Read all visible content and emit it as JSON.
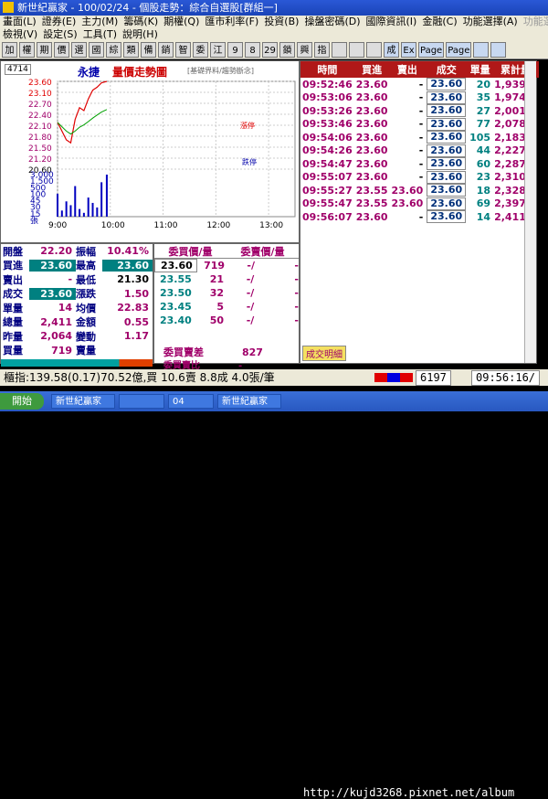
{
  "window": {
    "title": "新世紀贏家 - 100/02/24 - 個股走勢：綜合自選股[群組一]"
  },
  "menu": {
    "row1": [
      "畫面(L)",
      "證券(E)",
      "主力(M)",
      "籌碼(K)",
      "期權(Q)",
      "匯市利率(F)",
      "投資(B)",
      "操盤密碼(D)",
      "國際資訊(I)",
      "金融(C)",
      "功能選擇(A)",
      "功能選擇(V)"
    ],
    "row2": [
      "檢視(V)",
      "設定(S)",
      "工具(T)",
      "說明(H)"
    ]
  },
  "toolbar": {
    "buttons": [
      "加",
      "權",
      "期",
      "價",
      "選",
      "國",
      "綜",
      "類",
      "備",
      "銷",
      "智",
      "委",
      "江",
      "9",
      "8",
      "29",
      "鎖",
      "興",
      "指",
      "",
      "",
      "",
      "成",
      "Ex",
      "Page",
      "Page",
      "",
      ""
    ]
  },
  "chart": {
    "code": "4714",
    "stock_name": "永捷",
    "title": "量價走勢圖",
    "note": "[基礎界料/趨勢斷念]",
    "price_ticks": [
      "23.60",
      "23.10",
      "22.70",
      "22.40",
      "22.10",
      "21.80",
      "21.50",
      "21.20",
      "20.60"
    ],
    "vol_ticks": [
      "3,000",
      "1,500",
      "500",
      "100",
      "45",
      "30",
      "15",
      "張"
    ],
    "time_ticks": [
      "9:00",
      "10:00",
      "11:00",
      "12:00",
      "13:00"
    ],
    "ref_labels": [
      "漲停",
      "跌停"
    ]
  },
  "chart_data": {
    "type": "line",
    "x": [
      "09:00",
      "09:05",
      "09:10",
      "09:15",
      "09:20",
      "09:25",
      "09:30",
      "09:35",
      "09:40",
      "09:45",
      "09:50",
      "09:56"
    ],
    "series": [
      {
        "values": [
          22.2,
          21.9,
          21.6,
          21.5,
          22.3,
          22.7,
          22.6,
          23.0,
          23.3,
          23.4,
          23.55,
          23.6
        ]
      }
    ],
    "ylim": [
      20.6,
      23.6
    ],
    "xlim": [
      "09:00",
      "13:30"
    ],
    "volume": [
      30,
      8,
      20,
      15,
      40,
      10,
      5,
      25,
      18,
      12,
      45,
      55
    ]
  },
  "ticks": {
    "headers": [
      "時間",
      "買進",
      "賣出",
      "成交",
      "單量",
      "累計量"
    ],
    "rows": [
      {
        "time": "09:52:46",
        "bid": "23.60",
        "ask": "",
        "chg": "-",
        "last": "23.60",
        "vol": "20",
        "total": "1,939"
      },
      {
        "time": "09:53:06",
        "bid": "23.60",
        "ask": "",
        "chg": "-",
        "last": "23.60",
        "vol": "35",
        "total": "1,974"
      },
      {
        "time": "09:53:26",
        "bid": "23.60",
        "ask": "",
        "chg": "-",
        "last": "23.60",
        "vol": "27",
        "total": "2,001"
      },
      {
        "time": "09:53:46",
        "bid": "23.60",
        "ask": "",
        "chg": "-",
        "last": "23.60",
        "vol": "77",
        "total": "2,078"
      },
      {
        "time": "09:54:06",
        "bid": "23.60",
        "ask": "",
        "chg": "-",
        "last": "23.60",
        "vol": "105",
        "total": "2,183"
      },
      {
        "time": "09:54:26",
        "bid": "23.60",
        "ask": "",
        "chg": "-",
        "last": "23.60",
        "vol": "44",
        "total": "2,227"
      },
      {
        "time": "09:54:47",
        "bid": "23.60",
        "ask": "",
        "chg": "-",
        "last": "23.60",
        "vol": "60",
        "total": "2,287"
      },
      {
        "time": "09:55:07",
        "bid": "23.60",
        "ask": "",
        "chg": "-",
        "last": "23.60",
        "vol": "23",
        "total": "2,310"
      },
      {
        "time": "09:55:27",
        "bid": "23.55",
        "ask": "23.60",
        "chg": "",
        "last": "23.60",
        "vol": "18",
        "total": "2,328"
      },
      {
        "time": "09:55:47",
        "bid": "23.55",
        "ask": "23.60",
        "chg": "",
        "last": "23.60",
        "vol": "69",
        "total": "2,397"
      },
      {
        "time": "09:56:07",
        "bid": "23.60",
        "ask": "",
        "chg": "-",
        "last": "23.60",
        "vol": "14",
        "total": "2,411"
      }
    ],
    "footer_tab": "成交明細"
  },
  "quote": {
    "rows": [
      {
        "l1": "開盤",
        "v1": "22.20",
        "l2": "振幅",
        "v2": "10.41%"
      },
      {
        "l1": "買進",
        "v1": "23.60",
        "l2": "最高",
        "v2": "23.60"
      },
      {
        "l1": "賣出",
        "v1": "-",
        "l2": "最低",
        "v2": "21.30"
      },
      {
        "l1": "成交",
        "v1": "23.60",
        "l2": "漲跌",
        "v2": "1.50"
      },
      {
        "l1": "單量",
        "v1": "14",
        "l2": "均價",
        "v2": "22.83"
      },
      {
        "l1": "總量",
        "v1": "2,411",
        "l2": "金額",
        "v2": "0.55"
      },
      {
        "l1": "昨量",
        "v1": "2,064",
        "l2": "變動",
        "v2": "1.17"
      },
      {
        "l1": "買量",
        "v1": "719",
        "l2": "賣量",
        "v2": ""
      }
    ]
  },
  "book": {
    "bid_header": "委買價/量",
    "ask_header": "委賣價/量",
    "rows": [
      {
        "bp": "23.60",
        "bq": "719",
        "ap": "-/",
        "aq": "-"
      },
      {
        "bp": "23.55",
        "bq": "21",
        "ap": "-/",
        "aq": "-"
      },
      {
        "bp": "23.50",
        "bq": "32",
        "ap": "-/",
        "aq": "-"
      },
      {
        "bp": "23.45",
        "bq": "5",
        "ap": "-/",
        "aq": "-"
      },
      {
        "bp": "23.40",
        "bq": "50",
        "ap": "-/",
        "aq": "-"
      }
    ],
    "diff_label": "委買賣差",
    "diff_value": "827",
    "ratio_label": "委買賣比",
    "ratio_value": "-"
  },
  "statusbar": {
    "index_text": "櫃指:139.58(0.17)70.52億,買 10.6賣 8.8成 4.0張/筆",
    "code": "6197",
    "time": "09:56:16/"
  },
  "taskbar": {
    "start": "開始",
    "tasks": [
      "新世紀贏家",
      "",
      "04",
      "新世紀贏家"
    ]
  },
  "watermark": "http://kujd3268.pixnet.net/album"
}
